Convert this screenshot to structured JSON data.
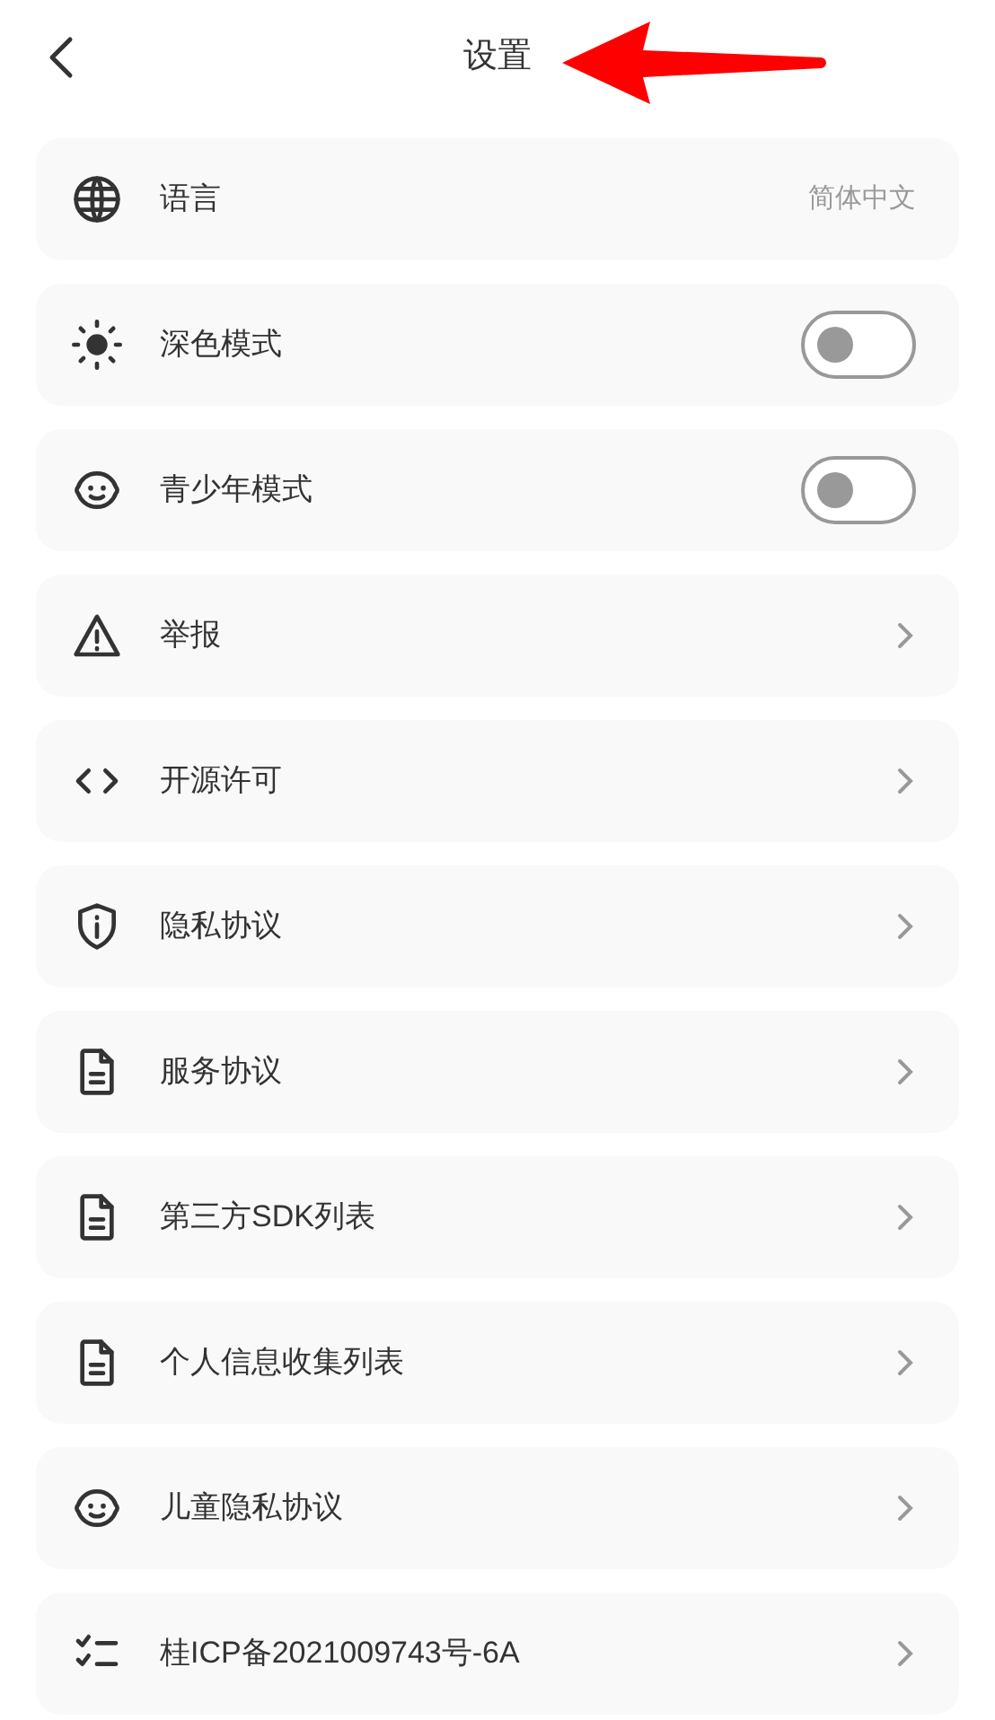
{
  "header": {
    "title": "设置"
  },
  "items": [
    {
      "kind": "value",
      "label": "语言",
      "value": "简体中文"
    },
    {
      "kind": "toggle",
      "label": "深色模式",
      "on": false
    },
    {
      "kind": "toggle",
      "label": "青少年模式",
      "on": false
    },
    {
      "kind": "link",
      "label": "举报"
    },
    {
      "kind": "link",
      "label": "开源许可"
    },
    {
      "kind": "link",
      "label": "隐私协议"
    },
    {
      "kind": "link",
      "label": "服务协议"
    },
    {
      "kind": "link",
      "label": "第三方SDK列表"
    },
    {
      "kind": "link",
      "label": "个人信息收集列表"
    },
    {
      "kind": "link",
      "label": "儿童隐私协议"
    },
    {
      "kind": "link",
      "label": "桂ICP备2021009743号-6A"
    }
  ]
}
